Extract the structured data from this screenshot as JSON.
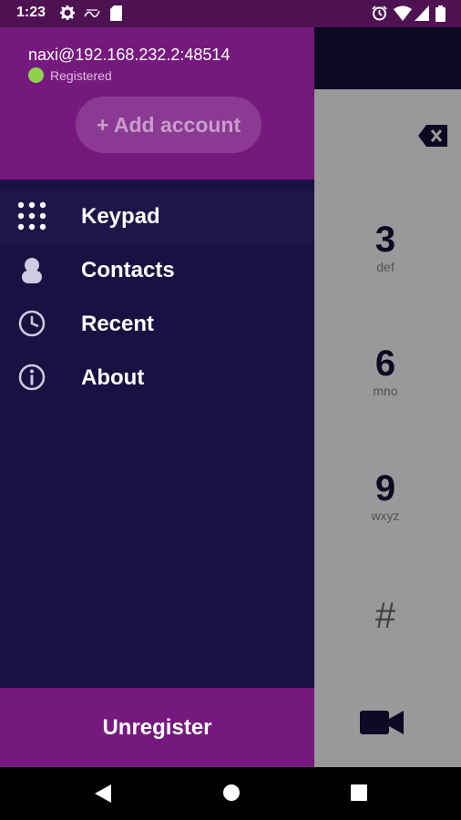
{
  "status_bar": {
    "time": "1:23",
    "icons": [
      "settings-gear-icon",
      "notification-icon",
      "sim-card-icon",
      "alarm-icon",
      "wifi-icon",
      "cellular-signal-icon",
      "battery-icon"
    ]
  },
  "drawer": {
    "account": {
      "name": "naxi@192.168.232.2:48514",
      "status": "Registered",
      "status_color": "#8fd14f"
    },
    "add_account_label": "+ Add account",
    "menu": [
      {
        "label": "Keypad",
        "icon": "keypad-icon"
      },
      {
        "label": "Contacts",
        "icon": "contacts-icon"
      },
      {
        "label": "Recent",
        "icon": "recent-clock-icon"
      },
      {
        "label": "About",
        "icon": "info-icon"
      }
    ],
    "unregister_label": "Unregister"
  },
  "dialer": {
    "keys": [
      {
        "digit": "3",
        "letters": "def"
      },
      {
        "digit": "6",
        "letters": "mno"
      },
      {
        "digit": "9",
        "letters": "wxyz"
      },
      {
        "digit": "#",
        "letters": ""
      }
    ]
  },
  "nav_bar": {
    "buttons": [
      "back-icon",
      "home-icon",
      "recents-icon"
    ]
  },
  "colors": {
    "drawer_header": "#76197e",
    "drawer_body": "#1a1142",
    "status_bar": "#4e1253"
  }
}
